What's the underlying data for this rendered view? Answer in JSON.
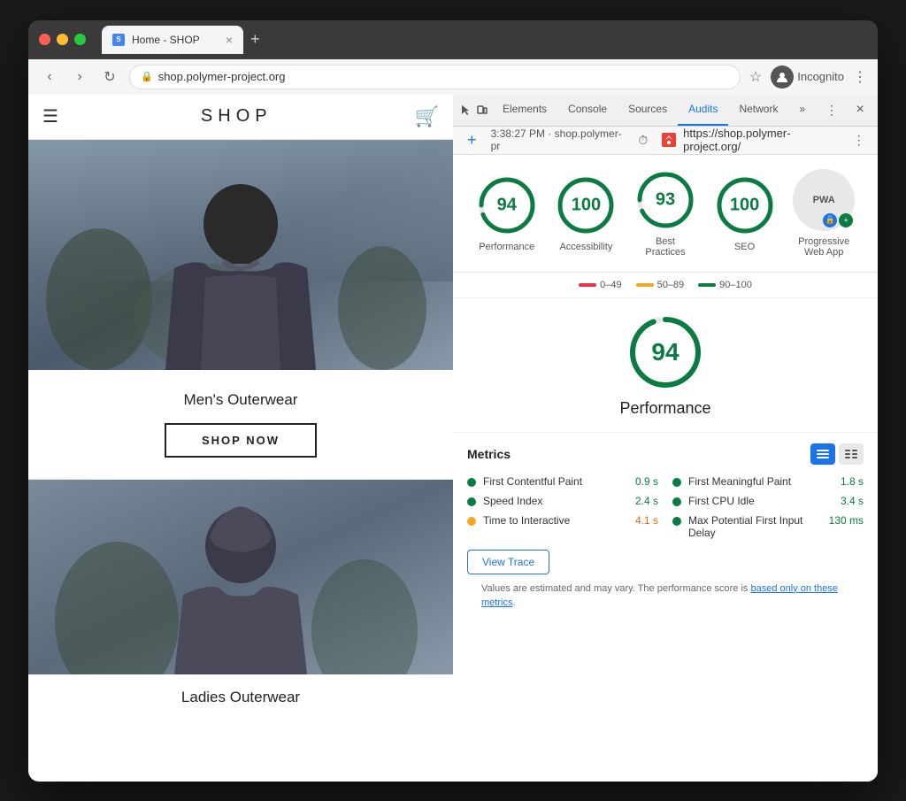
{
  "browser": {
    "title": "Home - SHOP",
    "url": "shop.polymer-project.org",
    "url_full": "https://shop.polymer-project.org/",
    "timestamp": "3:38:27 PM · shop.polymer-pr",
    "incognito_label": "Incognito"
  },
  "devtools": {
    "tabs": [
      "Audits",
      "Sources",
      "Elements",
      "Console",
      "Network"
    ],
    "active_tab": "Audits"
  },
  "shop": {
    "logo": "SHOP",
    "hero_category": "Men's Outerwear",
    "shop_now": "SHOP NOW",
    "ladies_category": "Ladies Outerwear"
  },
  "audit": {
    "url": "https://shop.polymer-project.org/",
    "scores": [
      {
        "id": "performance",
        "value": 94,
        "label": "Performance",
        "color": "#0a7c42"
      },
      {
        "id": "accessibility",
        "value": 100,
        "label": "Accessibility",
        "color": "#0a7c42"
      },
      {
        "id": "best-practices",
        "value": 93,
        "label": "Best Practices",
        "color": "#0a7c42"
      },
      {
        "id": "seo",
        "value": 100,
        "label": "SEO",
        "color": "#0a7c42"
      }
    ],
    "pwa_label": "Progressive Web App",
    "legend": [
      {
        "range": "0–49",
        "color": "#e8304a"
      },
      {
        "range": "50–89",
        "color": "#f5a623"
      },
      {
        "range": "90–100",
        "color": "#0a7c42"
      }
    ],
    "detail_score": 94,
    "detail_title": "Performance",
    "metrics_title": "Metrics",
    "metrics": [
      {
        "name": "First Contentful Paint",
        "value": "0.9 s",
        "color": "green",
        "col": 0
      },
      {
        "name": "First Meaningful Paint",
        "value": "1.8 s",
        "color": "green",
        "col": 1
      },
      {
        "name": "Speed Index",
        "value": "2.4 s",
        "color": "green",
        "col": 0
      },
      {
        "name": "First CPU Idle",
        "value": "3.4 s",
        "color": "green",
        "col": 1
      },
      {
        "name": "Time to Interactive",
        "value": "4.1 s",
        "color": "orange",
        "col": 0
      },
      {
        "name": "Max Potential First Input Delay",
        "value": "130 ms",
        "color": "green",
        "col": 1
      }
    ],
    "view_trace": "View Trace",
    "footer_text": "Values are estimated and may vary. The performance score is ",
    "footer_link": "based only on these metrics",
    "footer_end": "."
  }
}
